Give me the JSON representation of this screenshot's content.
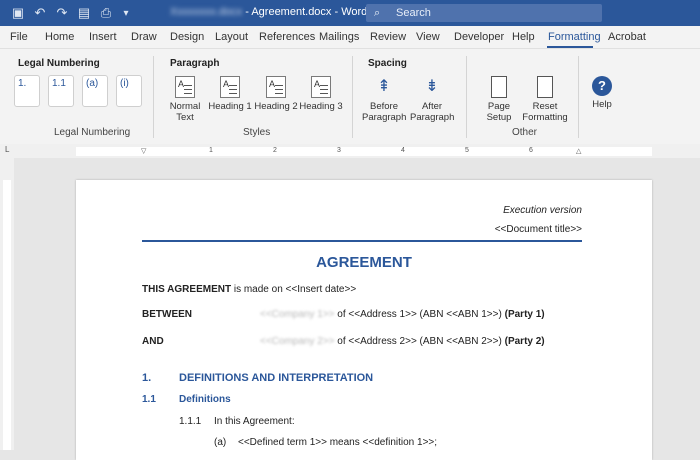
{
  "titlebar": {
    "title_prefix": "Xxxxxxxx.docx",
    "title_sep": " - ",
    "title_doc": "Agreement.docx - Word",
    "search_placeholder": "Search"
  },
  "menu": {
    "tabs": [
      "File",
      "Home",
      "Insert",
      "Draw",
      "Design",
      "Layout",
      "References",
      "Mailings",
      "Review",
      "View",
      "Developer",
      "Help",
      "Formatting",
      "Acrobat"
    ],
    "active": "Formatting"
  },
  "ribbon": {
    "legal_numbering": {
      "title": "Legal Numbering",
      "footer": "Legal Numbering",
      "buttons": [
        "1.",
        "1.1",
        "(a)",
        "(i)"
      ]
    },
    "paragraph": {
      "title": "Paragraph",
      "footer": "Styles",
      "styles": [
        {
          "label_1": "Normal",
          "label_2": "Text"
        },
        {
          "label_1": "Heading 1",
          "label_2": ""
        },
        {
          "label_1": "Heading 2",
          "label_2": ""
        },
        {
          "label_1": "Heading 3",
          "label_2": ""
        }
      ]
    },
    "spacing": {
      "title": "Spacing",
      "before_1": "Before",
      "before_2": "Paragraph",
      "after_1": "After",
      "after_2": "Paragraph"
    },
    "other": {
      "footer": "Other",
      "page_setup": "Page Setup",
      "reset_1": "Reset",
      "reset_2": "Formatting",
      "help": "Help"
    }
  },
  "ruler": {
    "numbers": [
      "1",
      "2",
      "3",
      "4",
      "5",
      "6"
    ]
  },
  "document": {
    "execution": "Execution version",
    "doc_title": "<<Document title>>",
    "heading": "AGREEMENT",
    "made_bold": "THIS AGREEMENT",
    "made_rest": " is made on <<Insert date>>",
    "between_label": "BETWEEN",
    "company1": "<<Company 1>>",
    "party1_rest": " of <<Address 1>> (ABN <<ABN 1>>) ",
    "party1_tag": "(Party 1)",
    "and_label": "AND",
    "company2": "<<Company 2>>",
    "party2_rest": " of <<Address 2>> (ABN <<ABN 2>>) ",
    "party2_tag": "(Party 2)",
    "s1_num": "1.",
    "s1_title": "DEFINITIONS AND INTERPRETATION",
    "s11_num": "1.1",
    "s11_title": "Definitions",
    "s111_num": "1.1.1",
    "s111_text": "In this Agreement:",
    "a_num": "(a)",
    "a_text": "<<Defined term 1>> means <<definition 1>>;"
  }
}
